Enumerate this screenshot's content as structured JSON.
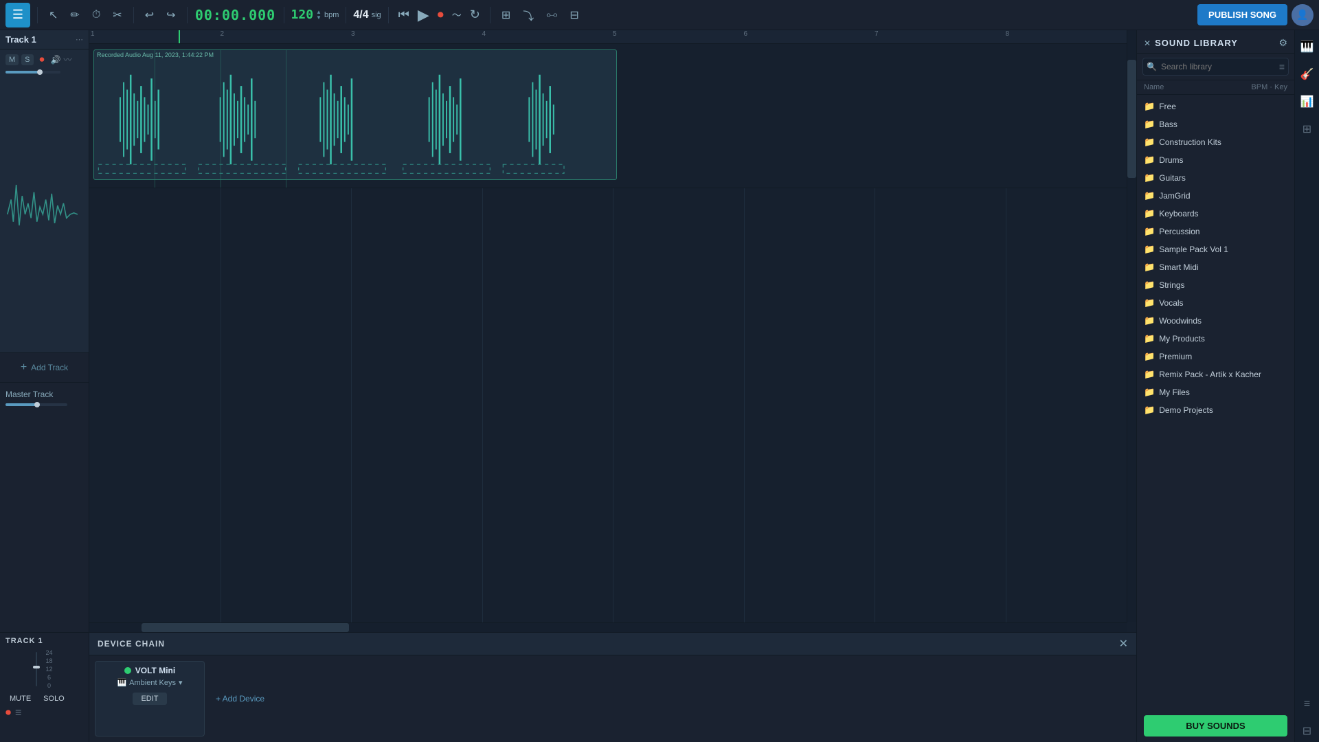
{
  "toolbar": {
    "menu_icon": "☰",
    "tools": [
      {
        "name": "select-tool",
        "icon": "↖",
        "label": "Select"
      },
      {
        "name": "pencil-tool",
        "icon": "✏",
        "label": "Pencil"
      },
      {
        "name": "clock-tool",
        "icon": "🕐",
        "label": "Clock"
      },
      {
        "name": "cut-tool",
        "icon": "✂",
        "label": "Cut"
      },
      {
        "name": "undo-btn",
        "icon": "↩",
        "label": "Undo"
      },
      {
        "name": "redo-btn",
        "icon": "↪",
        "label": "Redo"
      }
    ],
    "time": "00:00.000",
    "bpm": "120",
    "bpm_label": "bpm",
    "sig": "4/4",
    "sig_label": "sig",
    "transport": [
      {
        "name": "skip-back-btn",
        "icon": "⏮",
        "label": "Skip Back"
      },
      {
        "name": "play-btn",
        "icon": "▶",
        "label": "Play"
      },
      {
        "name": "record-btn",
        "icon": "⏺",
        "label": "Record"
      }
    ],
    "extra_tools": [
      {
        "name": "wave-btn",
        "icon": "〜",
        "label": "Wave"
      },
      {
        "name": "loop-btn",
        "icon": "↻",
        "label": "Loop"
      },
      {
        "name": "snap-btn",
        "icon": "⊞",
        "label": "Snap"
      },
      {
        "name": "cpu-btn",
        "icon": "⚡",
        "label": "CPU"
      },
      {
        "name": "plugin-btn",
        "icon": "⧩",
        "label": "Plugin"
      },
      {
        "name": "grid-btn",
        "icon": "⊟",
        "label": "Grid"
      }
    ],
    "publish_label": "PUBLISH SONG"
  },
  "track1": {
    "name": "Track 1",
    "clip_label": "Recorded Audio Aug 11, 2023, 1:44:22 PM",
    "controls": {
      "m_label": "M",
      "s_label": "S"
    }
  },
  "add_track": {
    "icon": "+",
    "label": "Add Track"
  },
  "master_track": {
    "label": "Master Track"
  },
  "bottom_panel": {
    "track_label": "TRACK 1",
    "device_chain_title": "DEVICE CHAIN",
    "close_icon": "✕",
    "device": {
      "name": "VOLT Mini",
      "preset": "Ambient Keys",
      "edit_label": "EDIT"
    },
    "add_device_label": "+ Add Device",
    "mute_label": "MUTE",
    "solo_label": "SOLO"
  },
  "sound_library": {
    "title": "SOUND LIBRARY",
    "close_icon": "✕",
    "search_placeholder": "Search library",
    "col_name": "Name",
    "col_bpm": "BPM",
    "col_key": "Key",
    "items": [
      {
        "name": "Free",
        "type": "folder"
      },
      {
        "name": "Bass",
        "type": "folder"
      },
      {
        "name": "Construction Kits",
        "type": "folder"
      },
      {
        "name": "Drums",
        "type": "folder"
      },
      {
        "name": "Guitars",
        "type": "folder"
      },
      {
        "name": "JamGrid",
        "type": "folder"
      },
      {
        "name": "Keyboards",
        "type": "folder"
      },
      {
        "name": "Percussion",
        "type": "folder"
      },
      {
        "name": "Sample Pack Vol 1",
        "type": "folder"
      },
      {
        "name": "Smart Midi",
        "type": "folder"
      },
      {
        "name": "Strings",
        "type": "folder"
      },
      {
        "name": "Vocals",
        "type": "folder"
      },
      {
        "name": "Woodwinds",
        "type": "folder"
      },
      {
        "name": "My Products",
        "type": "folder"
      },
      {
        "name": "Premium",
        "type": "folder"
      },
      {
        "name": "Remix Pack - Artik x Kacher",
        "type": "folder"
      },
      {
        "name": "My Files",
        "type": "folder"
      },
      {
        "name": "Demo Projects",
        "type": "folder"
      }
    ],
    "buy_sounds_label": "BUY SOUNDS"
  },
  "ruler": {
    "marks": [
      "1",
      "2",
      "3",
      "4",
      "5",
      "6",
      "7",
      "8"
    ]
  },
  "colors": {
    "accent_green": "#2ecc71",
    "accent_blue": "#1e90c8",
    "waveform": "#3abfaa",
    "bg_dark": "#16202e",
    "bg_mid": "#1a2230"
  }
}
